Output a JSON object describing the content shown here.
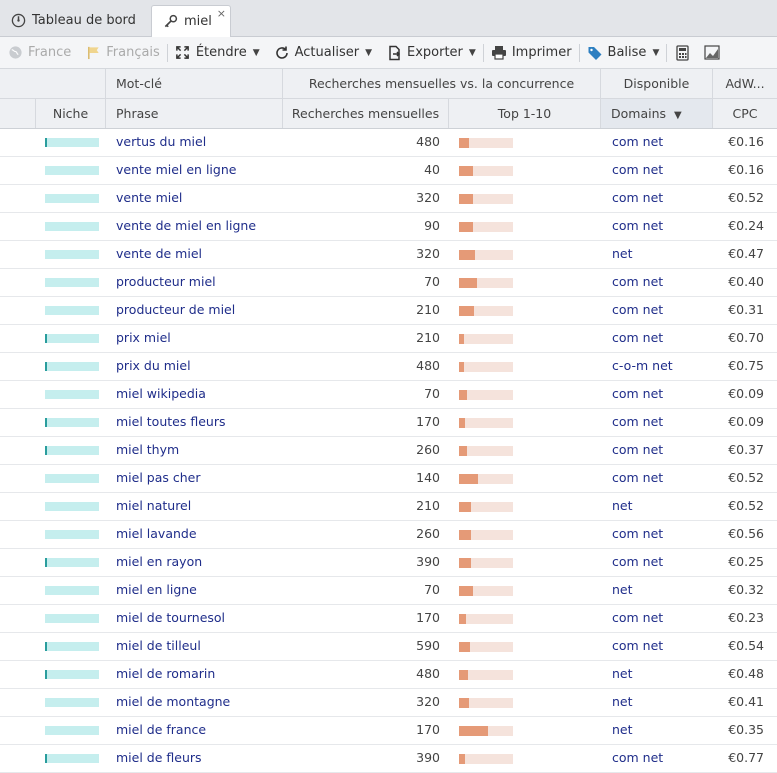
{
  "tabs": [
    {
      "label": "Tableau de bord",
      "icon": "dashboard-icon"
    },
    {
      "label": "miel",
      "icon": "key-icon",
      "close": "×"
    }
  ],
  "toolbar": {
    "country": "France",
    "language": "Français",
    "expand": "Étendre",
    "refresh": "Actualiser",
    "export": "Exporter",
    "print": "Imprimer",
    "tag": "Balise"
  },
  "header_groups": {
    "keyword": "Mot-clé",
    "searches": "Recherches mensuelles vs. la concurrence",
    "available": "Disponible",
    "adwords": "AdW..."
  },
  "columns": {
    "niche": "Niche",
    "phrase": "Phrase",
    "volume": "Recherches mensuelles",
    "top": "Top 1-10",
    "domains": "Domains",
    "cpc": "CPC"
  },
  "colors": {
    "niche_bar": "#c5eeee",
    "niche_tick": "#2a9d9d",
    "top_track": "#f5e3dc",
    "top_fill": "#e59a77",
    "link": "#1f2d8a"
  },
  "rows": [
    {
      "phrase": "vertus du miel",
      "volume": "480",
      "top_fraction": 0.19,
      "domains": "com net",
      "cpc": "€0.16",
      "niche_tick": true
    },
    {
      "phrase": "vente miel en ligne",
      "volume": "40",
      "top_fraction": 0.26,
      "domains": "com net",
      "cpc": "€0.16",
      "niche_tick": false
    },
    {
      "phrase": "vente miel",
      "volume": "320",
      "top_fraction": 0.26,
      "domains": "com net",
      "cpc": "€0.52",
      "niche_tick": false
    },
    {
      "phrase": "vente de miel en ligne",
      "volume": "90",
      "top_fraction": 0.26,
      "domains": "com net",
      "cpc": "€0.24",
      "niche_tick": false
    },
    {
      "phrase": "vente de miel",
      "volume": "320",
      "top_fraction": 0.3,
      "domains": "net",
      "cpc": "€0.47",
      "niche_tick": false
    },
    {
      "phrase": "producteur miel",
      "volume": "70",
      "top_fraction": 0.33,
      "domains": "com net",
      "cpc": "€0.40",
      "niche_tick": false
    },
    {
      "phrase": "producteur de miel",
      "volume": "210",
      "top_fraction": 0.28,
      "domains": "com net",
      "cpc": "€0.31",
      "niche_tick": false
    },
    {
      "phrase": "prix miel",
      "volume": "210",
      "top_fraction": 0.09,
      "domains": "com net",
      "cpc": "€0.70",
      "niche_tick": true
    },
    {
      "phrase": "prix du miel",
      "volume": "480",
      "top_fraction": 0.09,
      "domains": "c-o-m net",
      "cpc": "€0.75",
      "niche_tick": true
    },
    {
      "phrase": "miel wikipedia",
      "volume": "70",
      "top_fraction": 0.15,
      "domains": "com net",
      "cpc": "€0.09",
      "niche_tick": false
    },
    {
      "phrase": "miel toutes fleurs",
      "volume": "170",
      "top_fraction": 0.11,
      "domains": "com net",
      "cpc": "€0.09",
      "niche_tick": true
    },
    {
      "phrase": "miel thym",
      "volume": "260",
      "top_fraction": 0.15,
      "domains": "com net",
      "cpc": "€0.37",
      "niche_tick": true
    },
    {
      "phrase": "miel pas cher",
      "volume": "140",
      "top_fraction": 0.35,
      "domains": "com net",
      "cpc": "€0.52",
      "niche_tick": false
    },
    {
      "phrase": "miel naturel",
      "volume": "210",
      "top_fraction": 0.22,
      "domains": "net",
      "cpc": "€0.52",
      "niche_tick": false
    },
    {
      "phrase": "miel lavande",
      "volume": "260",
      "top_fraction": 0.22,
      "domains": "com net",
      "cpc": "€0.56",
      "niche_tick": false
    },
    {
      "phrase": "miel en rayon",
      "volume": "390",
      "top_fraction": 0.22,
      "domains": "com net",
      "cpc": "€0.25",
      "niche_tick": true
    },
    {
      "phrase": "miel en ligne",
      "volume": "70",
      "top_fraction": 0.26,
      "domains": "net",
      "cpc": "€0.32",
      "niche_tick": false
    },
    {
      "phrase": "miel de tournesol",
      "volume": "170",
      "top_fraction": 0.13,
      "domains": "com net",
      "cpc": "€0.23",
      "niche_tick": false
    },
    {
      "phrase": "miel de tilleul",
      "volume": "590",
      "top_fraction": 0.2,
      "domains": "com net",
      "cpc": "€0.54",
      "niche_tick": true
    },
    {
      "phrase": "miel de romarin",
      "volume": "480",
      "top_fraction": 0.17,
      "domains": "net",
      "cpc": "€0.48",
      "niche_tick": true
    },
    {
      "phrase": "miel de montagne",
      "volume": "320",
      "top_fraction": 0.19,
      "domains": "net",
      "cpc": "€0.41",
      "niche_tick": false
    },
    {
      "phrase": "miel de france",
      "volume": "170",
      "top_fraction": 0.54,
      "domains": "net",
      "cpc": "€0.35",
      "niche_tick": false
    },
    {
      "phrase": "miel de fleurs",
      "volume": "390",
      "top_fraction": 0.11,
      "domains": "com net",
      "cpc": "€0.77",
      "niche_tick": true
    }
  ]
}
